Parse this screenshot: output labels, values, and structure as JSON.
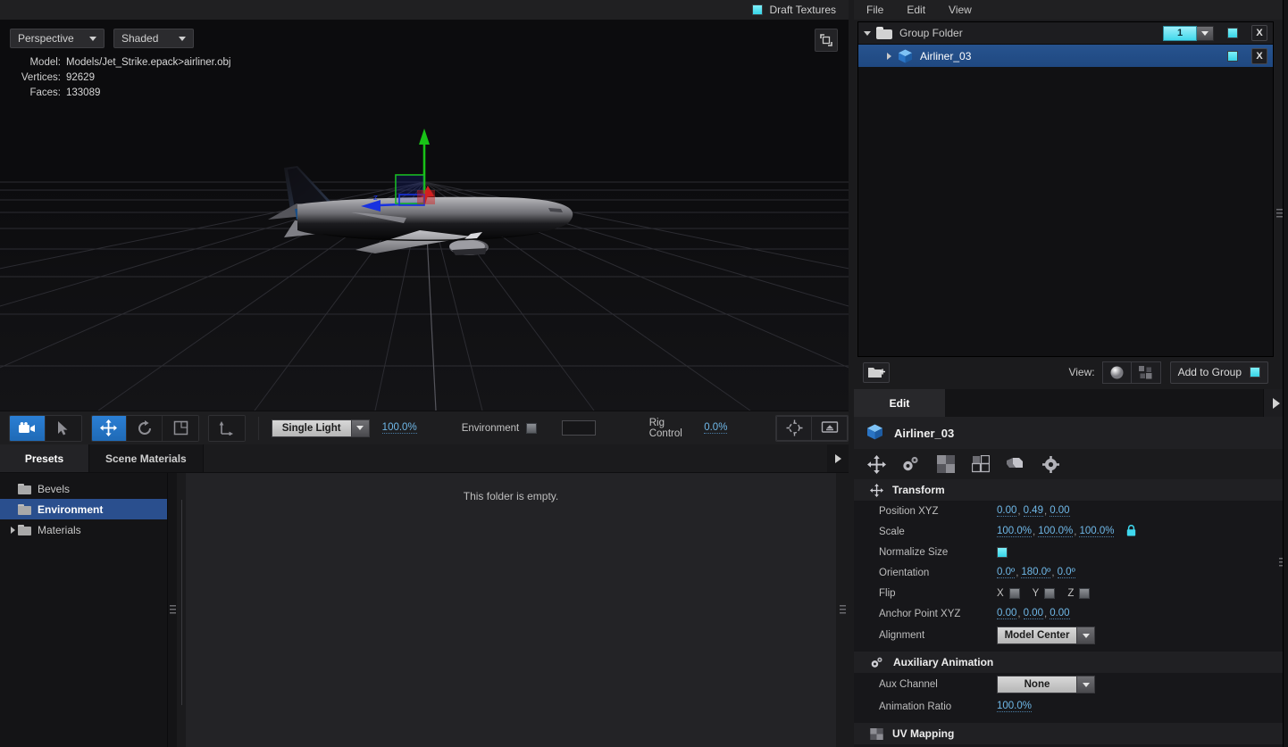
{
  "viewport": {
    "draft_textures_label": "Draft Textures",
    "draft_textures_checked": true,
    "projection": "Perspective",
    "shading": "Shaded",
    "info": {
      "model_label": "Model:",
      "model_value": "Models/Jet_Strike.epack>airliner.obj",
      "vertices_label": "Vertices:",
      "vertices_value": "92629",
      "faces_label": "Faces:",
      "faces_value": "133089"
    },
    "accent_blue": "#2b7fd4",
    "grid_color": "#3a3a3f"
  },
  "viewport_toolbar": {
    "tools": [
      {
        "name": "camera-tool",
        "active": true
      },
      {
        "name": "select-tool",
        "active": false
      },
      {
        "name": "move-tool",
        "active": true
      },
      {
        "name": "rotate-tool",
        "active": false
      },
      {
        "name": "scale-tool",
        "active": false
      },
      {
        "name": "axis-tool",
        "active": false
      }
    ],
    "light_preset": "Single Light",
    "light_intensity": "100.0%",
    "environment_label": "Environment",
    "environment_checked": false,
    "environment_color": "#161618",
    "rig_control_label": "Rig Control",
    "rig_control_value": "0.0%"
  },
  "presets": {
    "tabs": [
      {
        "label": "Presets",
        "active": true
      },
      {
        "label": "Scene Materials",
        "active": false
      }
    ],
    "tree": [
      {
        "label": "Bevels",
        "selected": false,
        "expandable": false
      },
      {
        "label": "Environment",
        "selected": true,
        "expandable": false
      },
      {
        "label": "Materials",
        "selected": false,
        "expandable": true
      }
    ],
    "browser_empty_text": "This folder is empty."
  },
  "menubar": {
    "items": [
      "File",
      "Edit",
      "View"
    ]
  },
  "outliner": {
    "rows": [
      {
        "name": "Group Folder",
        "type": "folder",
        "selected": false,
        "expanded": true,
        "count": "1",
        "visible": true,
        "close_label": "X"
      },
      {
        "name": "Airliner_03",
        "type": "object",
        "selected": true,
        "expanded": false,
        "count": null,
        "visible": true,
        "close_label": "X"
      }
    ],
    "toolbar": {
      "view_label": "View:",
      "add_to_group_label": "Add to Group",
      "add_to_group_checked": true
    }
  },
  "editor": {
    "tabs": [
      {
        "label": "Edit",
        "active": true
      }
    ],
    "object_name": "Airliner_03",
    "property_icons": [
      "transform-icon",
      "auxiliary-animation-icon",
      "uv-mapping-icon",
      "layers-icon",
      "bevel-icon",
      "settings-gear-icon"
    ],
    "sections": [
      {
        "title": "Transform",
        "icon": "move-arrows-icon",
        "rows": [
          {
            "label": "Position XYZ",
            "type": "triple",
            "values": [
              "0.00",
              "0.49",
              "0.00"
            ]
          },
          {
            "label": "Scale",
            "type": "triple-lock",
            "values": [
              "100.0%",
              "100.0%",
              "100.0%"
            ],
            "locked": true
          },
          {
            "label": "Normalize Size",
            "type": "checkbox",
            "checked": true
          },
          {
            "label": "Orientation",
            "type": "triple",
            "values": [
              "0.0º",
              "180.0º",
              "0.0º"
            ]
          },
          {
            "label": "Flip",
            "type": "flip",
            "axes": [
              "X",
              "Y",
              "Z"
            ],
            "checked": [
              false,
              false,
              false
            ]
          },
          {
            "label": "Anchor Point XYZ",
            "type": "triple",
            "values": [
              "0.00",
              "0.00",
              "0.00"
            ]
          },
          {
            "label": "Alignment",
            "type": "select",
            "value": "Model Center"
          }
        ]
      },
      {
        "title": "Auxiliary Animation",
        "icon": "gears-icon",
        "rows": [
          {
            "label": "Aux Channel",
            "type": "select",
            "value": "None"
          },
          {
            "label": "Animation Ratio",
            "type": "single",
            "values": [
              "100.0%"
            ]
          }
        ]
      },
      {
        "title": "UV Mapping",
        "icon": "checker-icon",
        "rows": []
      }
    ]
  }
}
